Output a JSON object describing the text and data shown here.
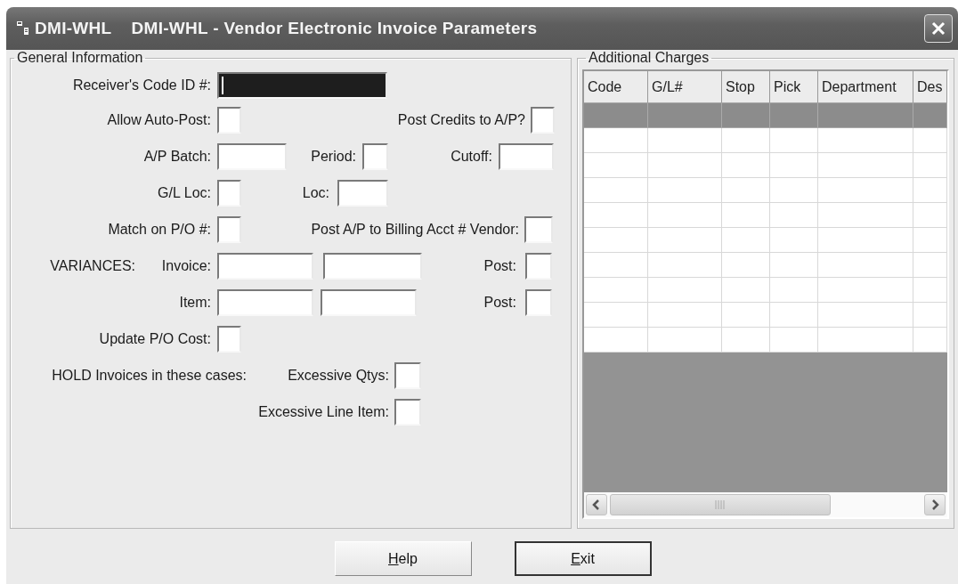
{
  "window": {
    "app_code": "DMI-WHL",
    "title": "DMI-WHL - Vendor Electronic Invoice Parameters"
  },
  "general_information": {
    "title": "General Information",
    "rows": [
      [
        {
          "kind": "label",
          "text": "Receiver's Code ID #:"
        },
        {
          "kind": "field",
          "focused": true
        }
      ],
      [
        {
          "kind": "label",
          "text": "Allow Auto-Post:"
        },
        {
          "kind": "box"
        },
        {
          "kind": "label",
          "text": "Post Credits to A/P?"
        },
        {
          "kind": "box"
        }
      ],
      [
        {
          "kind": "label",
          "text": "A/P Batch:"
        },
        {
          "kind": "field",
          "focused": false
        },
        {
          "kind": "label",
          "text": "Period:"
        },
        {
          "kind": "box"
        },
        {
          "kind": "label",
          "text": "Cutoff:"
        },
        {
          "kind": "field",
          "focused": false
        }
      ],
      [
        {
          "kind": "label",
          "text": "G/L Loc:"
        },
        {
          "kind": "box"
        },
        {
          "kind": "label",
          "text": "Loc:"
        },
        {
          "kind": "field",
          "focused": false
        }
      ],
      [
        {
          "kind": "label",
          "text": "Match on P/O #:"
        },
        {
          "kind": "box"
        },
        {
          "kind": "label",
          "text": "Post A/P to Billing Acct # Vendor:"
        },
        {
          "kind": "box"
        }
      ],
      {
        "heading": "VARIANCES:",
        "items": [
          {
            "kind": "label",
            "text": "Invoice:"
          },
          {
            "kind": "field",
            "focused": false
          },
          {
            "kind": "field",
            "focused": false
          },
          {
            "kind": "label",
            "text": "Post:"
          },
          {
            "kind": "box"
          }
        ]
      },
      [
        {
          "kind": "label",
          "text": "Item:"
        },
        {
          "kind": "field",
          "focused": false
        },
        {
          "kind": "field",
          "focused": false
        },
        {
          "kind": "label",
          "text": "Post:"
        },
        {
          "kind": "box"
        }
      ],
      [
        {
          "kind": "label",
          "text": "Update P/O Cost:"
        },
        {
          "kind": "box"
        }
      ],
      {
        "heading": "HOLD Invoices in these cases:",
        "items": [
          {
            "kind": "label",
            "text": "Excessive Qtys:"
          },
          {
            "kind": "box"
          }
        ]
      },
      [
        {
          "kind": "label",
          "text": "Excessive Line Item:"
        },
        {
          "kind": "box"
        }
      ]
    ]
  },
  "additional_charges": {
    "title": "Additional Charges",
    "table": {
      "columns": [
        "Code",
        "G/L#",
        "Stop",
        "Pick",
        "Department",
        "Des"
      ],
      "rows": [
        {
          "selected": true
        },
        {
          "selected": false
        },
        {
          "selected": false
        },
        {
          "selected": false
        },
        {
          "selected": false
        },
        {
          "selected": false
        },
        {
          "selected": false
        },
        {
          "selected": false
        },
        {
          "selected": false
        },
        {
          "selected": false
        }
      ]
    }
  },
  "buttons": [
    {
      "mnemonic": "H",
      "rest": "elp",
      "default": false
    },
    {
      "mnemonic": "E",
      "rest": "xit",
      "default": true
    }
  ]
}
